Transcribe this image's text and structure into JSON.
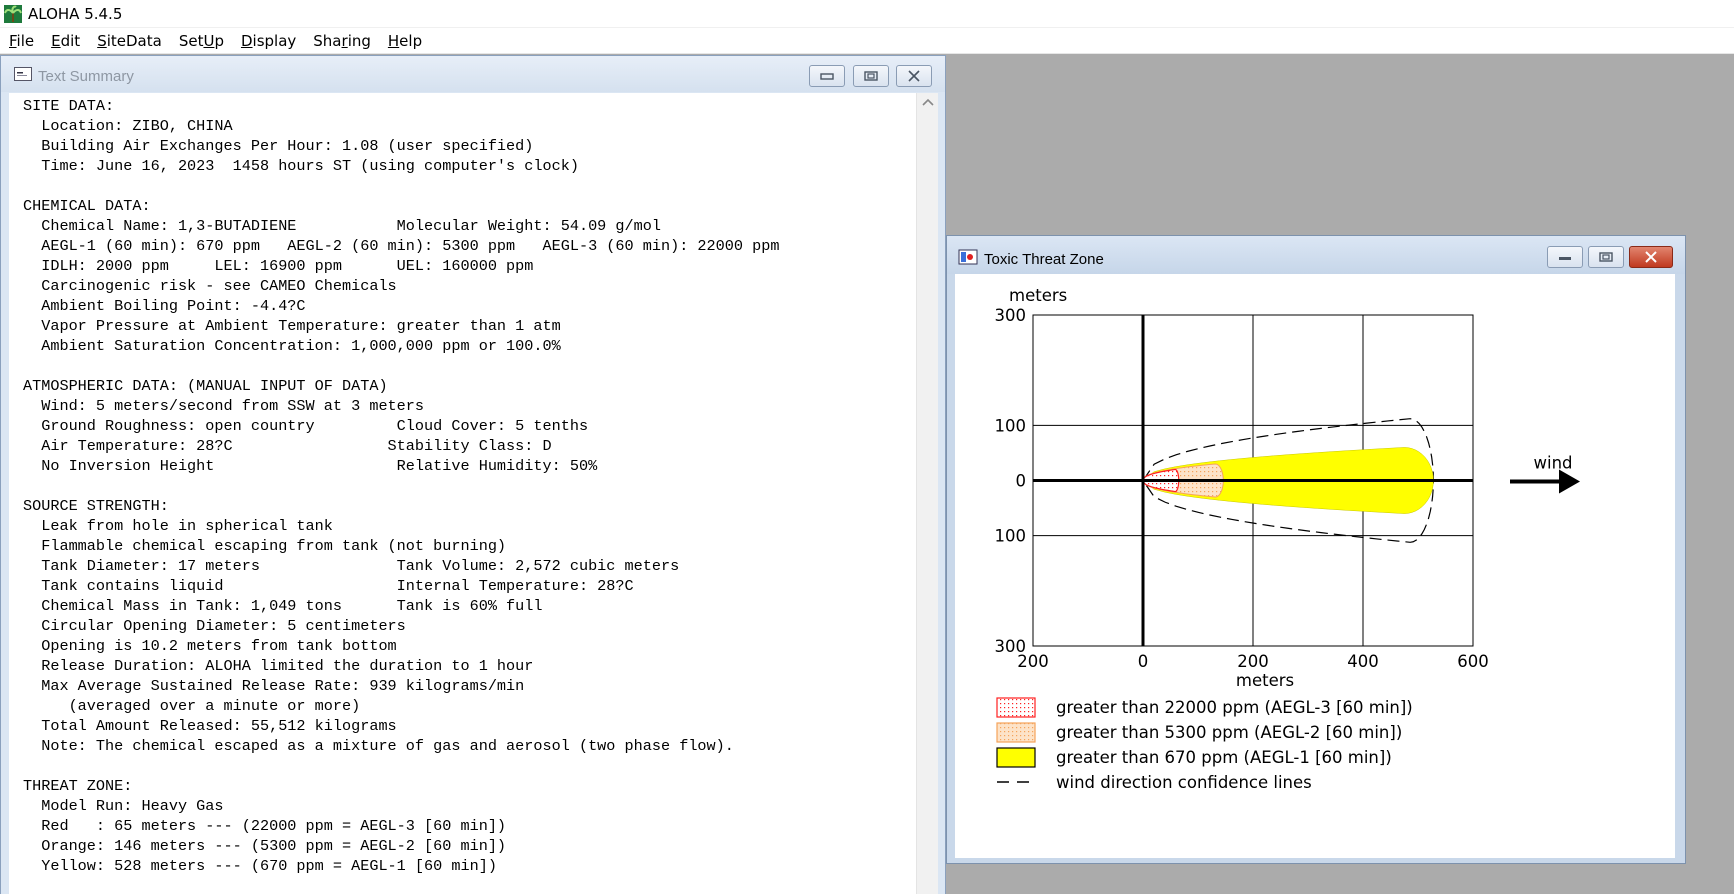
{
  "app": {
    "title": "ALOHA 5.4.5",
    "menu": [
      {
        "pre": "",
        "mn": "F",
        "post": "ile"
      },
      {
        "pre": "",
        "mn": "E",
        "post": "dit"
      },
      {
        "pre": "",
        "mn": "S",
        "post": "iteData"
      },
      {
        "pre": "Set",
        "mn": "U",
        "post": "p"
      },
      {
        "pre": "",
        "mn": "D",
        "post": "isplay"
      },
      {
        "pre": "Sha",
        "mn": "r",
        "post": "ing"
      },
      {
        "pre": "",
        "mn": "H",
        "post": "elp"
      }
    ]
  },
  "text_summary": {
    "title": "Text Summary",
    "lines": [
      "SITE DATA:",
      "  Location: ZIBO, CHINA",
      "  Building Air Exchanges Per Hour: 1.08 (user specified)",
      "  Time: June 16, 2023  1458 hours ST (using computer's clock)",
      "",
      "CHEMICAL DATA:",
      "  Chemical Name: 1,3-BUTADIENE           Molecular Weight: 54.09 g/mol",
      "  AEGL-1 (60 min): 670 ppm   AEGL-2 (60 min): 5300 ppm   AEGL-3 (60 min): 22000 ppm",
      "  IDLH: 2000 ppm     LEL: 16900 ppm      UEL: 160000 ppm",
      "  Carcinogenic risk - see CAMEO Chemicals",
      "  Ambient Boiling Point: -4.4?C",
      "  Vapor Pressure at Ambient Temperature: greater than 1 atm",
      "  Ambient Saturation Concentration: 1,000,000 ppm or 100.0%",
      "",
      "ATMOSPHERIC DATA: (MANUAL INPUT OF DATA)",
      "  Wind: 5 meters/second from SSW at 3 meters",
      "  Ground Roughness: open country         Cloud Cover: 5 tenths",
      "  Air Temperature: 28?C                 Stability Class: D",
      "  No Inversion Height                    Relative Humidity: 50%",
      "",
      "SOURCE STRENGTH:",
      "  Leak from hole in spherical tank",
      "  Flammable chemical escaping from tank (not burning)",
      "  Tank Diameter: 17 meters               Tank Volume: 2,572 cubic meters",
      "  Tank contains liquid                   Internal Temperature: 28?C",
      "  Chemical Mass in Tank: 1,049 tons      Tank is 60% full",
      "  Circular Opening Diameter: 5 centimeters",
      "  Opening is 10.2 meters from tank bottom",
      "  Release Duration: ALOHA limited the duration to 1 hour",
      "  Max Average Sustained Release Rate: 939 kilograms/min",
      "     (averaged over a minute or more)",
      "  Total Amount Released: 55,512 kilograms",
      "  Note: The chemical escaped as a mixture of gas and aerosol (two phase flow).",
      "",
      "THREAT ZONE:",
      "  Model Run: Heavy Gas",
      "  Red   : 65 meters --- (22000 ppm = AEGL-3 [60 min])",
      "  Orange: 146 meters --- (5300 ppm = AEGL-2 [60 min])",
      "  Yellow: 528 meters --- (670 ppm = AEGL-1 [60 min])"
    ]
  },
  "threat_zone": {
    "title": "Toxic Threat Zone",
    "wind_label": "wind",
    "legend": [
      {
        "label": "greater than 22000 ppm (AEGL-3 [60 min])",
        "swatch": "red-dotted"
      },
      {
        "label": "greater than 5300 ppm (AEGL-2 [60 min])",
        "swatch": "orange-dotted"
      },
      {
        "label": "greater than 670 ppm (AEGL-1 [60 min])",
        "swatch": "yellow-solid"
      },
      {
        "label": "wind direction confidence lines",
        "swatch": "dashed-line"
      }
    ],
    "colors": {
      "red": "#ff2020",
      "orange": "#f5a35a",
      "yellow": "#ffff00",
      "orange_fill": "#fde3c8"
    }
  },
  "chart_data": {
    "type": "area",
    "xlabel": "meters",
    "ylabel": "meters",
    "xlim": [
      -200,
      600
    ],
    "ylim": [
      -300,
      300
    ],
    "x_ticks": [
      -200,
      0,
      200,
      400,
      600
    ],
    "x_tick_labels": [
      "200",
      "0",
      "200",
      "400",
      "600"
    ],
    "y_ticks": [
      300,
      100,
      0,
      -100,
      -300
    ],
    "y_tick_labels": [
      "300",
      "100",
      "0",
      "100",
      "300"
    ],
    "series": [
      {
        "name": "greater than 22000 ppm (AEGL-3 [60 min])",
        "color": "#ff2020",
        "max_downwind_m": 65,
        "half_width_m": 20
      },
      {
        "name": "greater than 5300 ppm (AEGL-2 [60 min])",
        "color": "#f5a35a",
        "max_downwind_m": 146,
        "half_width_m": 30
      },
      {
        "name": "greater than 670 ppm (AEGL-1 [60 min])",
        "color": "#ffff00",
        "max_downwind_m": 528,
        "half_width_m": 60
      },
      {
        "name": "wind direction confidence lines",
        "color": "#000000",
        "max_downwind_m": 528,
        "half_width_m": 112
      }
    ]
  }
}
